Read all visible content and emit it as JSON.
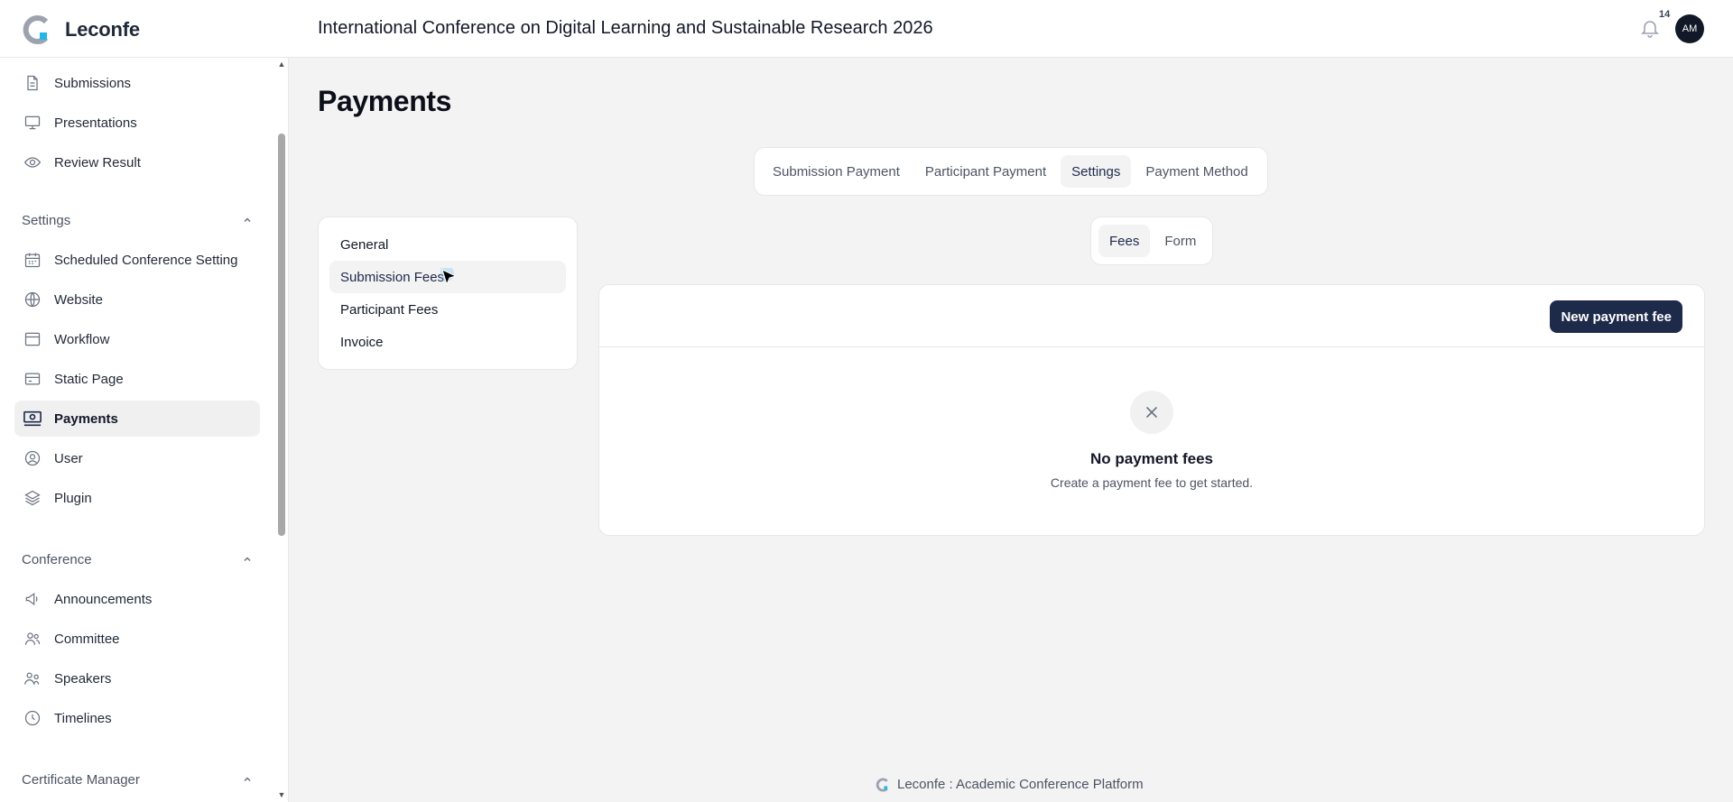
{
  "header": {
    "brand": "Leconfe",
    "conference_title": "International Conference on Digital Learning and Sustainable Research 2026",
    "notification_count": "14",
    "avatar_initials": "AM"
  },
  "sidebar": {
    "items_top": [
      {
        "label": "Submissions",
        "icon": "document-icon"
      },
      {
        "label": "Presentations",
        "icon": "monitor-icon"
      },
      {
        "label": "Review Result",
        "icon": "eye-icon"
      }
    ],
    "settings_title": "Settings",
    "settings_items": [
      {
        "label": "Scheduled Conference Setting",
        "icon": "calendar-icon"
      },
      {
        "label": "Website",
        "icon": "globe-icon"
      },
      {
        "label": "Workflow",
        "icon": "window-icon"
      },
      {
        "label": "Static Page",
        "icon": "card-icon"
      },
      {
        "label": "Payments",
        "icon": "payment-icon",
        "active": true
      },
      {
        "label": "User",
        "icon": "user-icon"
      },
      {
        "label": "Plugin",
        "icon": "layers-icon"
      }
    ],
    "conference_title": "Conference",
    "conference_items": [
      {
        "label": "Announcements",
        "icon": "megaphone-icon"
      },
      {
        "label": "Committee",
        "icon": "users-icon"
      },
      {
        "label": "Speakers",
        "icon": "speakers-icon"
      },
      {
        "label": "Timelines",
        "icon": "clock-icon"
      }
    ],
    "certificate_title": "Certificate Manager"
  },
  "main": {
    "page_title": "Payments",
    "tabs": [
      {
        "label": "Submission Payment"
      },
      {
        "label": "Participant Payment"
      },
      {
        "label": "Settings",
        "active": true
      },
      {
        "label": "Payment Method"
      }
    ],
    "sub_nav": [
      {
        "label": "General"
      },
      {
        "label": "Submission Fees",
        "active": true
      },
      {
        "label": "Participant Fees"
      },
      {
        "label": "Invoice"
      }
    ],
    "fee_tabs": [
      {
        "label": "Fees",
        "active": true
      },
      {
        "label": "Form"
      }
    ],
    "new_button": "New payment fee",
    "empty_title": "No payment fees",
    "empty_subtitle": "Create a payment fee to get started."
  },
  "footer": {
    "text": "Leconfe : Academic Conference Platform"
  },
  "colors": {
    "accent": "#1e2a4a",
    "logo_gray": "#9ca3af",
    "logo_accent": "#22b8e6"
  }
}
